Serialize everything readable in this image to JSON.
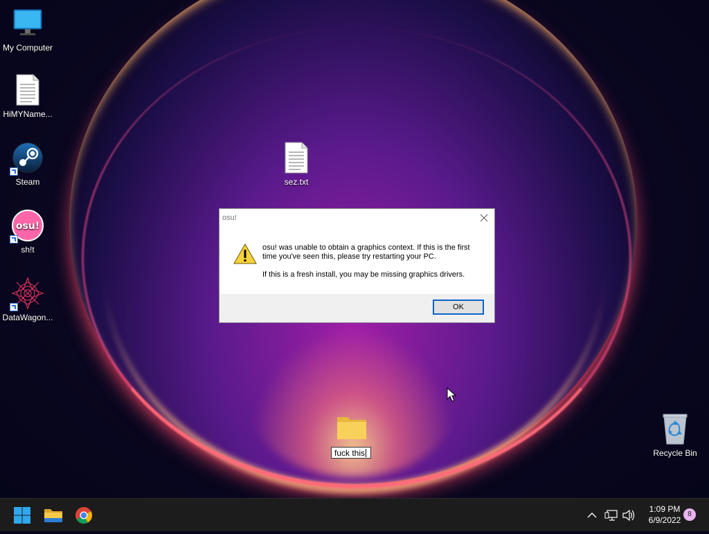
{
  "desktop": {
    "icons": [
      {
        "label": "My Computer",
        "icon": "monitor-icon"
      },
      {
        "label": "HiMYName...",
        "icon": "text-file-icon"
      },
      {
        "label": "Steam",
        "icon": "steam-icon"
      },
      {
        "label": "sh!t",
        "icon": "osu-icon",
        "badge": "osu!"
      },
      {
        "label": "DataWagon...",
        "icon": "datawagon-icon"
      },
      {
        "label": "sez.txt",
        "icon": "text-file-icon"
      },
      {
        "label": "Recycle Bin",
        "icon": "recycle-bin-icon"
      }
    ],
    "rename_folder": {
      "value": "fuck this",
      "icon": "folder-icon"
    }
  },
  "dialog": {
    "title": "osu!",
    "message_line1": "osu! was unable to obtain a graphics context. If this is the first time you've seen this, please try restarting your PC.",
    "message_line2": "If this is a fresh install, you may be missing graphics drivers.",
    "ok_label": "OK",
    "icon": "warning-icon"
  },
  "taskbar": {
    "pinned": [
      {
        "name": "start-button",
        "icon": "windows-logo-icon"
      },
      {
        "name": "file-explorer-button",
        "icon": "folder-icon"
      },
      {
        "name": "chrome-button",
        "icon": "chrome-icon"
      }
    ],
    "tray": {
      "time": "1:09 PM",
      "date": "6/9/2022",
      "notification_count": "8"
    }
  },
  "colors": {
    "taskbar_bg": "#1c1c1c",
    "dialog_footer": "#f0f0f0",
    "ok_border": "#0a64c8",
    "wallpaper_accent": "#ff4a6a"
  }
}
